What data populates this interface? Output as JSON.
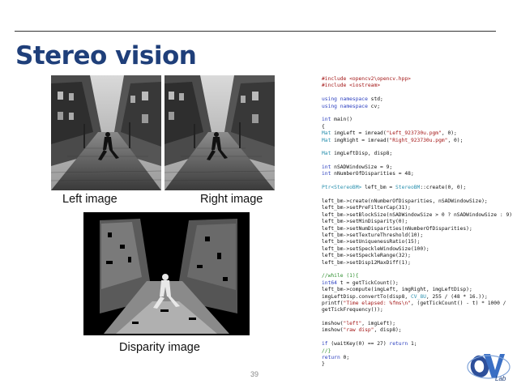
{
  "slide": {
    "title": "Stereo vision",
    "page_number": "39"
  },
  "captions": {
    "left": "Left image",
    "right": "Right image",
    "disparity": "Disparity image"
  },
  "images": {
    "left_icon": "street-photo-left",
    "right_icon": "street-photo-right",
    "disparity_icon": "disparity-map"
  },
  "code": {
    "lines": [
      [
        {
          "t": "#include <opencv2\\opencv.hpp>",
          "c": "str"
        }
      ],
      [
        {
          "t": "#include <iostream>",
          "c": "str"
        }
      ],
      [
        {
          "t": ""
        }
      ],
      [
        {
          "t": "using namespace",
          "c": "kw"
        },
        {
          "t": " std;"
        }
      ],
      [
        {
          "t": "using namespace",
          "c": "kw"
        },
        {
          "t": " cv;"
        }
      ],
      [
        {
          "t": ""
        }
      ],
      [
        {
          "t": "int",
          "c": "kw"
        },
        {
          "t": " main()"
        }
      ],
      [
        {
          "t": "{"
        }
      ],
      [
        {
          "t": "Mat",
          "c": "ty"
        },
        {
          "t": " imgLeft = imread("
        },
        {
          "t": "\"Left_923730u.pgm\"",
          "c": "str"
        },
        {
          "t": ", 0);"
        }
      ],
      [
        {
          "t": "Mat",
          "c": "ty"
        },
        {
          "t": " imgRight = imread("
        },
        {
          "t": "\"Right_923730u.pgm\"",
          "c": "str"
        },
        {
          "t": ", 0);"
        }
      ],
      [
        {
          "t": ""
        }
      ],
      [
        {
          "t": "Mat",
          "c": "ty"
        },
        {
          "t": " imgLeftDisp, disp8;"
        }
      ],
      [
        {
          "t": ""
        }
      ],
      [
        {
          "t": "int",
          "c": "kw"
        },
        {
          "t": " nSADWindowSize = 9;"
        }
      ],
      [
        {
          "t": "int",
          "c": "kw"
        },
        {
          "t": " nNumberOfDisparities = 48;"
        }
      ],
      [
        {
          "t": ""
        }
      ],
      [
        {
          "t": "Ptr<StereoBM>",
          "c": "ty"
        },
        {
          "t": " left_bm = "
        },
        {
          "t": "StereoBM",
          "c": "ty"
        },
        {
          "t": "::create(0, 0);"
        }
      ],
      [
        {
          "t": ""
        }
      ],
      [
        {
          "t": "left_bm->create(nNumberOfDisparities, nSADWindowSize);"
        }
      ],
      [
        {
          "t": "left_bm->setPreFilterCap(31);"
        }
      ],
      [
        {
          "t": "left_bm->setBlockSize(nSADWindowSize > 0 ? nSADWindowSize : 9);"
        }
      ],
      [
        {
          "t": "left_bm->setMinDisparity(0);"
        }
      ],
      [
        {
          "t": "left_bm->setNumDisparities(nNumberOfDisparities);"
        }
      ],
      [
        {
          "t": "left_bm->setTextureThreshold(10);"
        }
      ],
      [
        {
          "t": "left_bm->setUniquenessRatio(15);"
        }
      ],
      [
        {
          "t": "left_bm->setSpeckleWindowSize(100);"
        }
      ],
      [
        {
          "t": "left_bm->setSpeckleRange(32);"
        }
      ],
      [
        {
          "t": "left_bm->setDisp12MaxDiff(1);"
        }
      ],
      [
        {
          "t": ""
        }
      ],
      [
        {
          "t": "//while (1){",
          "c": "cm"
        }
      ],
      [
        {
          "t": "int64",
          "c": "kw"
        },
        {
          "t": " t = getTickCount();"
        }
      ],
      [
        {
          "t": "left_bm->compute(imgLeft, imgRight, imgLeftDisp);"
        }
      ],
      [
        {
          "t": "imgLeftDisp.convertTo(disp8, "
        },
        {
          "t": "CV_8U",
          "c": "ty"
        },
        {
          "t": ", 255 / (48 * 16.));"
        }
      ],
      [
        {
          "t": "printf("
        },
        {
          "t": "\"Time elapsed: %fms\\n\"",
          "c": "str"
        },
        {
          "t": ", (getTickCount() - t) * 1000 /"
        }
      ],
      [
        {
          "t": "getTickFrequency());"
        }
      ],
      [
        {
          "t": ""
        }
      ],
      [
        {
          "t": "imshow("
        },
        {
          "t": "\"left\"",
          "c": "str"
        },
        {
          "t": ", imgLeft);"
        }
      ],
      [
        {
          "t": "imshow("
        },
        {
          "t": "\"raw disp\"",
          "c": "str"
        },
        {
          "t": ", disp8);"
        }
      ],
      [
        {
          "t": ""
        }
      ],
      [
        {
          "t": "if",
          "c": "kw"
        },
        {
          "t": " (waitKey(0) == 27) "
        },
        {
          "t": "return",
          "c": "kw"
        },
        {
          "t": " 1;"
        }
      ],
      [
        {
          "t": "//}",
          "c": "cm"
        }
      ],
      [
        {
          "t": "return",
          "c": "kw"
        },
        {
          "t": " 0;"
        }
      ],
      [
        {
          "t": "}"
        }
      ]
    ]
  },
  "logo": {
    "text": "Lab",
    "icon": "cv-lab-logo-icon"
  },
  "colors": {
    "title": "#1f3f7a",
    "keyword": "#2b3fbf",
    "string": "#a31515",
    "comment": "#2f8f2f",
    "type": "#2b91af"
  }
}
